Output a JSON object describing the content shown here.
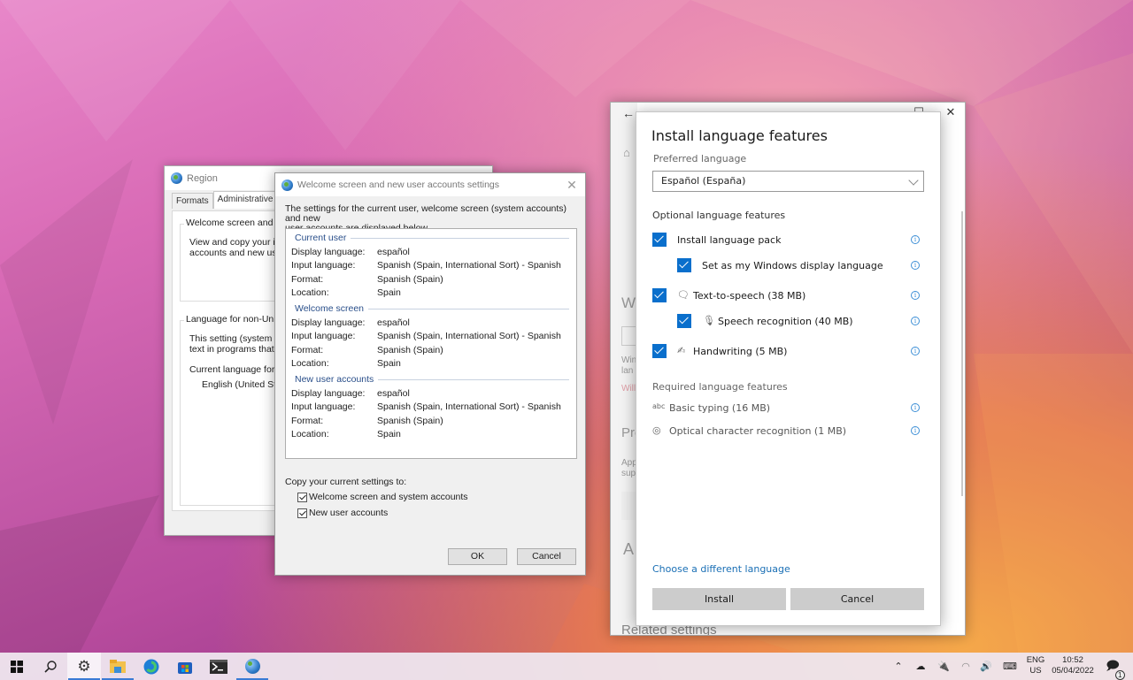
{
  "region_window": {
    "title": "Region",
    "tabs": [
      {
        "label": "Formats",
        "active": false
      },
      {
        "label": "Administrative",
        "active": true
      }
    ],
    "welcome_group": {
      "label": "Welcome screen and new",
      "text_line1": "View and copy your inte",
      "text_line2": "accounts and new user a"
    },
    "unicode_group": {
      "label": "Language for non-Unicod",
      "text_line1": "This setting (system loca",
      "text_line2": "text in programs that do",
      "current_label": "Current language for no",
      "current_value": "English (United State"
    }
  },
  "welcome_dialog": {
    "title": "Welcome screen and new user accounts settings",
    "intro_line1": "The settings for the current user, welcome screen (system accounts) and new",
    "intro_line2": "user accounts are displayed below.",
    "sections": [
      {
        "heading": "Current user",
        "rows": [
          {
            "key": "Display language:",
            "value": "español"
          },
          {
            "key": "Input language:",
            "value": "Spanish (Spain, International Sort) - Spanish"
          },
          {
            "key": "Format:",
            "value": "Spanish (Spain)"
          },
          {
            "key": "Location:",
            "value": "Spain"
          }
        ]
      },
      {
        "heading": "Welcome screen",
        "rows": [
          {
            "key": "Display language:",
            "value": "español"
          },
          {
            "key": "Input language:",
            "value": "Spanish (Spain, International Sort) - Spanish"
          },
          {
            "key": "Format:",
            "value": "Spanish (Spain)"
          },
          {
            "key": "Location:",
            "value": "Spain"
          }
        ]
      },
      {
        "heading": "New user accounts",
        "rows": [
          {
            "key": "Display language:",
            "value": "español"
          },
          {
            "key": "Input language:",
            "value": "Spanish (Spain, International Sort) - Spanish"
          },
          {
            "key": "Format:",
            "value": "Spanish (Spain)"
          },
          {
            "key": "Location:",
            "value": "Spain"
          }
        ]
      }
    ],
    "copy_label": "Copy your current settings to:",
    "checkboxes": [
      {
        "label": "Welcome screen and system accounts",
        "checked": true
      },
      {
        "label": "New user accounts",
        "checked": true
      }
    ],
    "ok_label": "OK",
    "cancel_label": "Cancel"
  },
  "settings_window": {
    "peek": {
      "heading_wi": "Wi",
      "win_text1": "Win",
      "win_text2": "lan",
      "will_text": "Will",
      "pre_heading": "Pre",
      "app_text1": "App",
      "app_text2": "sup",
      "a_heading": "A",
      "related": "Related settings"
    }
  },
  "install_dialog": {
    "title": "Install language features",
    "preferred_label": "Preferred language",
    "preferred_value": "Español (España)",
    "optional_label": "Optional language features",
    "optional_features": [
      {
        "label": "Install language pack",
        "checked": true,
        "icon": "",
        "indent": false
      },
      {
        "label": "Set as my Windows display language",
        "checked": true,
        "icon": "",
        "indent": true
      },
      {
        "label": "Text-to-speech (38 MB)",
        "checked": true,
        "icon": "text-to-speech-icon",
        "indent": false
      },
      {
        "label": "Speech recognition (40 MB)",
        "checked": true,
        "icon": "microphone-icon",
        "indent": true
      },
      {
        "label": "Handwriting (5 MB)",
        "checked": true,
        "icon": "handwriting-icon",
        "indent": false
      }
    ],
    "required_label": "Required language features",
    "required_features": [
      {
        "label": "Basic typing (16 MB)",
        "icon": "basic-typing-icon"
      },
      {
        "label": "Optical character recognition (1 MB)",
        "icon": "ocr-icon"
      }
    ],
    "link_label": "Choose a different language",
    "install_label": "Install",
    "cancel_label": "Cancel"
  },
  "taskbar": {
    "apps": [
      "start",
      "search",
      "settings",
      "file-explorer",
      "edge",
      "store",
      "terminal",
      "region"
    ],
    "tray": {
      "lang_top": "ENG",
      "lang_bottom": "US",
      "time": "10:52",
      "date": "05/04/2022",
      "notifications": "1"
    }
  }
}
